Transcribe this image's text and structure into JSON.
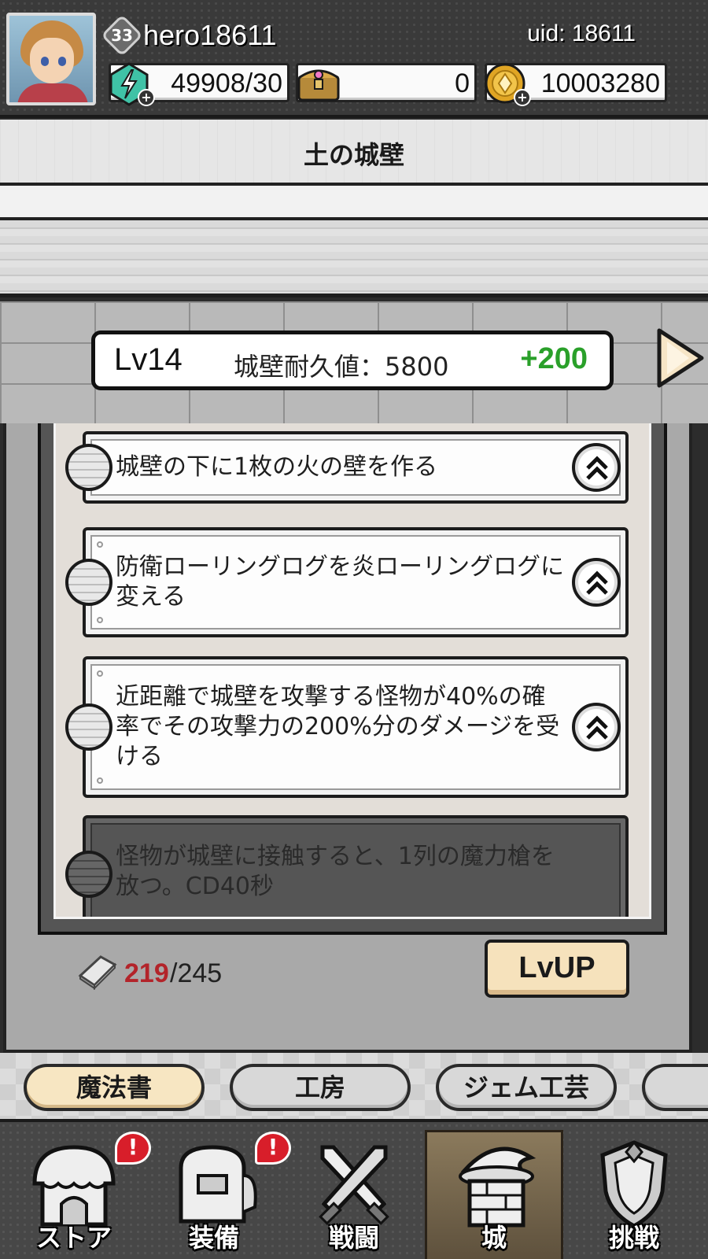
{
  "header": {
    "level": "33",
    "username": "hero18611",
    "uid": "uid: 18611",
    "resources": {
      "energy": "49908/30",
      "chest": "0",
      "coins": "10003280"
    }
  },
  "title": "土の城壁",
  "wall": {
    "level": "Lv14",
    "durability": "城壁耐久値：5800",
    "bonus": "+200"
  },
  "skills": [
    {
      "text": "城壁の下に1枚の火の壁を作る",
      "locked": false
    },
    {
      "text": "防衛ローリングログを炎ローリングログに変える",
      "locked": false
    },
    {
      "text": "近距離で城壁を攻撃する怪物が40%の確率でその攻撃力の200%分のダメージを受ける",
      "locked": false
    },
    {
      "text": "怪物が城壁に接触すると、1列の魔力槍を放つ。CD40秒",
      "locked": true
    }
  ],
  "upgrade": {
    "bricks_current": "219",
    "bricks_max": "/245",
    "button_label": "LvUP"
  },
  "subtabs": [
    "魔法書",
    "工房",
    "ジェム工芸",
    ""
  ],
  "nav": [
    {
      "label": "ストア",
      "badge": "!"
    },
    {
      "label": "装備",
      "badge": "!"
    },
    {
      "label": "戦闘",
      "badge": ""
    },
    {
      "label": "城",
      "badge": ""
    },
    {
      "label": "挑戦",
      "badge": ""
    }
  ],
  "colors": {
    "bonus": "#2aa02a",
    "brick_current": "#b3242a",
    "active_tab": "#f7e6c2",
    "notification": "#d81e2a"
  },
  "icons": {
    "energy": "energy-gem-icon",
    "chest": "treasure-chest-icon",
    "coin": "gold-coin-icon",
    "brick": "brick-icon",
    "up": "double-chevron-up-icon",
    "next": "play-arrow-icon"
  }
}
